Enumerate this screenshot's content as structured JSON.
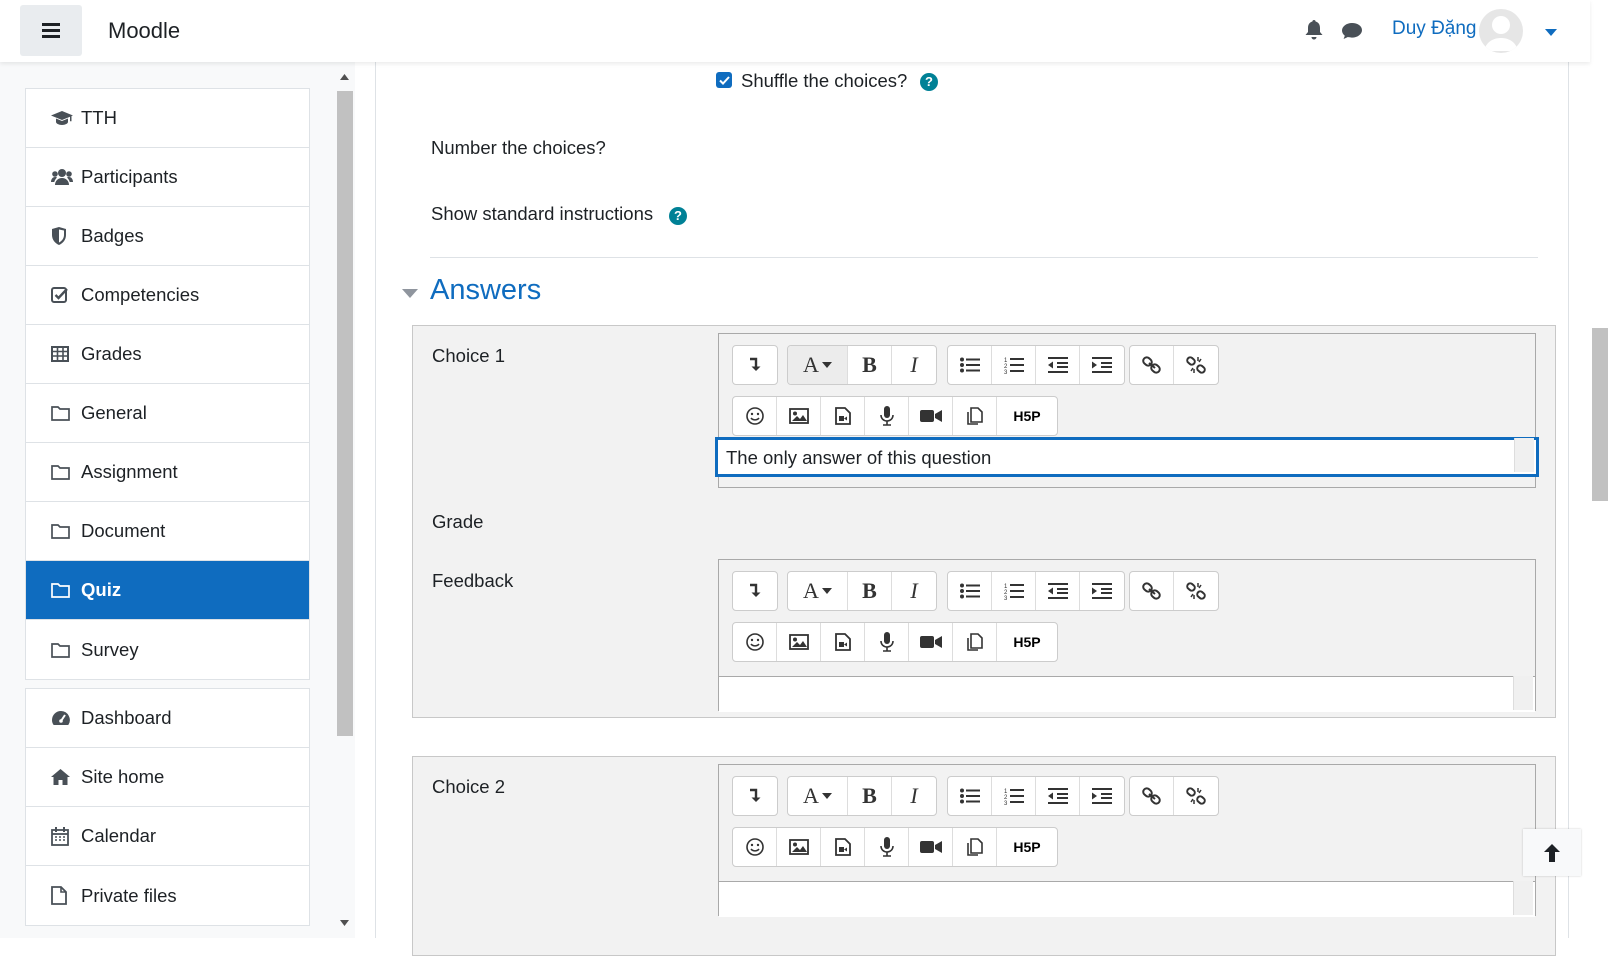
{
  "navbar": {
    "brand": "Moodle",
    "user_name": "Duy Đặng"
  },
  "drawer": {
    "course_items": [
      {
        "label": "TTH",
        "icon": "graduation-cap-icon"
      },
      {
        "label": "Participants",
        "icon": "users-icon"
      },
      {
        "label": "Badges",
        "icon": "shield-icon"
      },
      {
        "label": "Competencies",
        "icon": "check-square-icon"
      },
      {
        "label": "Grades",
        "icon": "table-icon"
      },
      {
        "label": "General",
        "icon": "folder-icon"
      },
      {
        "label": "Assignment",
        "icon": "folder-icon"
      },
      {
        "label": "Document",
        "icon": "folder-icon"
      },
      {
        "label": "Quiz",
        "icon": "folder-icon",
        "active": true
      },
      {
        "label": "Survey",
        "icon": "folder-icon"
      }
    ],
    "site_items": [
      {
        "label": "Dashboard",
        "icon": "tachometer-icon"
      },
      {
        "label": "Site home",
        "icon": "home-icon"
      },
      {
        "label": "Calendar",
        "icon": "calendar-icon"
      },
      {
        "label": "Private files",
        "icon": "file-icon"
      }
    ]
  },
  "form": {
    "shuffle_label": "Shuffle the choices?",
    "shuffle_checked": true,
    "number_label": "Number the choices?",
    "instructions_label": "Show standard instructions",
    "section_title": "Answers",
    "choice1_label": "Choice 1",
    "choice1_value": "The only answer of this question",
    "grade_label": "Grade",
    "feedback_label": "Feedback",
    "choice2_label": "Choice 2"
  },
  "toolbar": {
    "row1": [
      "collapse",
      "font-style",
      "bold",
      "italic",
      "unordered-list",
      "ordered-list",
      "outdent",
      "indent",
      "link",
      "unlink"
    ],
    "row2": [
      "emoticon",
      "image",
      "media",
      "record-audio",
      "record-video",
      "manage-files",
      "h5p"
    ],
    "h5p_label": "H5P"
  },
  "colors": {
    "primary": "#0f6cbf",
    "help": "#008196",
    "text": "#1d2125"
  }
}
